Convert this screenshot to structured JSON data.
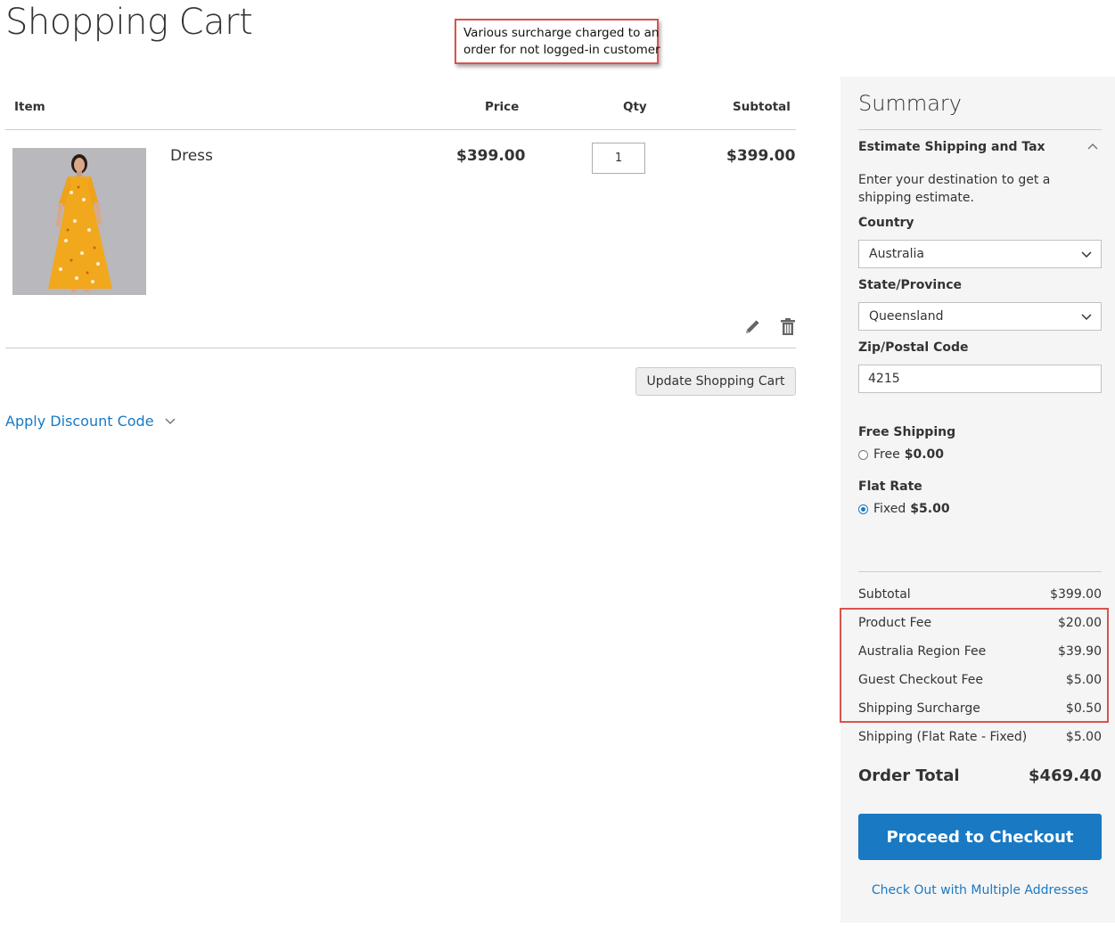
{
  "page": {
    "title": "Shopping Cart"
  },
  "callout": {
    "line1": "Various surcharge charged to an",
    "line2": "order for not logged-in customer"
  },
  "cart": {
    "headers": {
      "item": "Item",
      "price": "Price",
      "qty": "Qty",
      "subtotal": "Subtotal"
    },
    "items": [
      {
        "name": "Dress",
        "price": "$399.00",
        "qty": "1",
        "subtotal": "$399.00"
      }
    ],
    "update_label": "Update Shopping Cart",
    "discount_label": "Apply Discount Code"
  },
  "summary": {
    "title": "Summary",
    "estimate": {
      "title": "Estimate Shipping and Tax",
      "description": "Enter your destination to get a shipping estimate.",
      "country_label": "Country",
      "country_value": "Australia",
      "state_label": "State/Province",
      "state_value": "Queensland",
      "zip_label": "Zip/Postal Code",
      "zip_value": "4215"
    },
    "shipping": {
      "free": {
        "title": "Free Shipping",
        "option": "Free",
        "price": "$0.00",
        "selected": false
      },
      "flat": {
        "title": "Flat Rate",
        "option": "Fixed",
        "price": "$5.00",
        "selected": true
      }
    },
    "totals": [
      {
        "label": "Subtotal",
        "value": "$399.00"
      },
      {
        "label": "Product Fee",
        "value": "$20.00"
      },
      {
        "label": "Australia Region Fee",
        "value": "$39.90"
      },
      {
        "label": "Guest Checkout Fee",
        "value": "$5.00"
      },
      {
        "label": "Shipping Surcharge",
        "value": "$0.50"
      },
      {
        "label": "Shipping (Flat Rate - Fixed)",
        "value": "$5.00"
      }
    ],
    "order_total": {
      "label": "Order Total",
      "value": "$469.40"
    },
    "checkout_label": "Proceed to Checkout",
    "multi_address_label": "Check Out with Multiple Addresses"
  },
  "colors": {
    "accent": "#1979c3",
    "highlight": "#d9534f",
    "summary_bg": "#f5f5f5"
  }
}
